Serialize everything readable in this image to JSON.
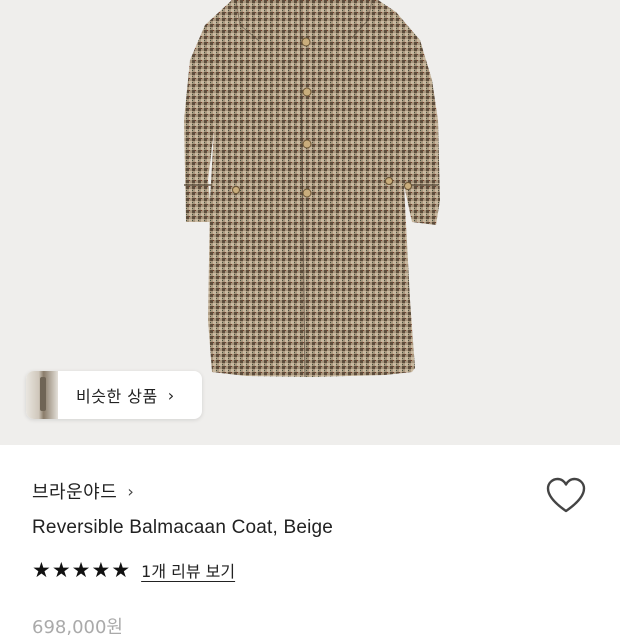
{
  "product_image": {
    "alt": "houndstooth coat"
  },
  "similar_products": {
    "label": "비슷한 상품",
    "chevron": "›"
  },
  "brand": {
    "name": "브라운야드",
    "chevron": "›"
  },
  "product": {
    "title": "Reversible Balmacaan Coat, Beige",
    "rating_stars": 5,
    "stars": [
      "★",
      "★",
      "★",
      "★",
      "★"
    ],
    "review_link": "1개 리뷰 보기",
    "price": "698,000원"
  },
  "icons": {
    "wishlist": "heart-outline-icon",
    "stars": "star-icon"
  },
  "colors": {
    "hero_bg": "#efeeec",
    "coat_base": "#8d7b65",
    "text": "#222222"
  }
}
